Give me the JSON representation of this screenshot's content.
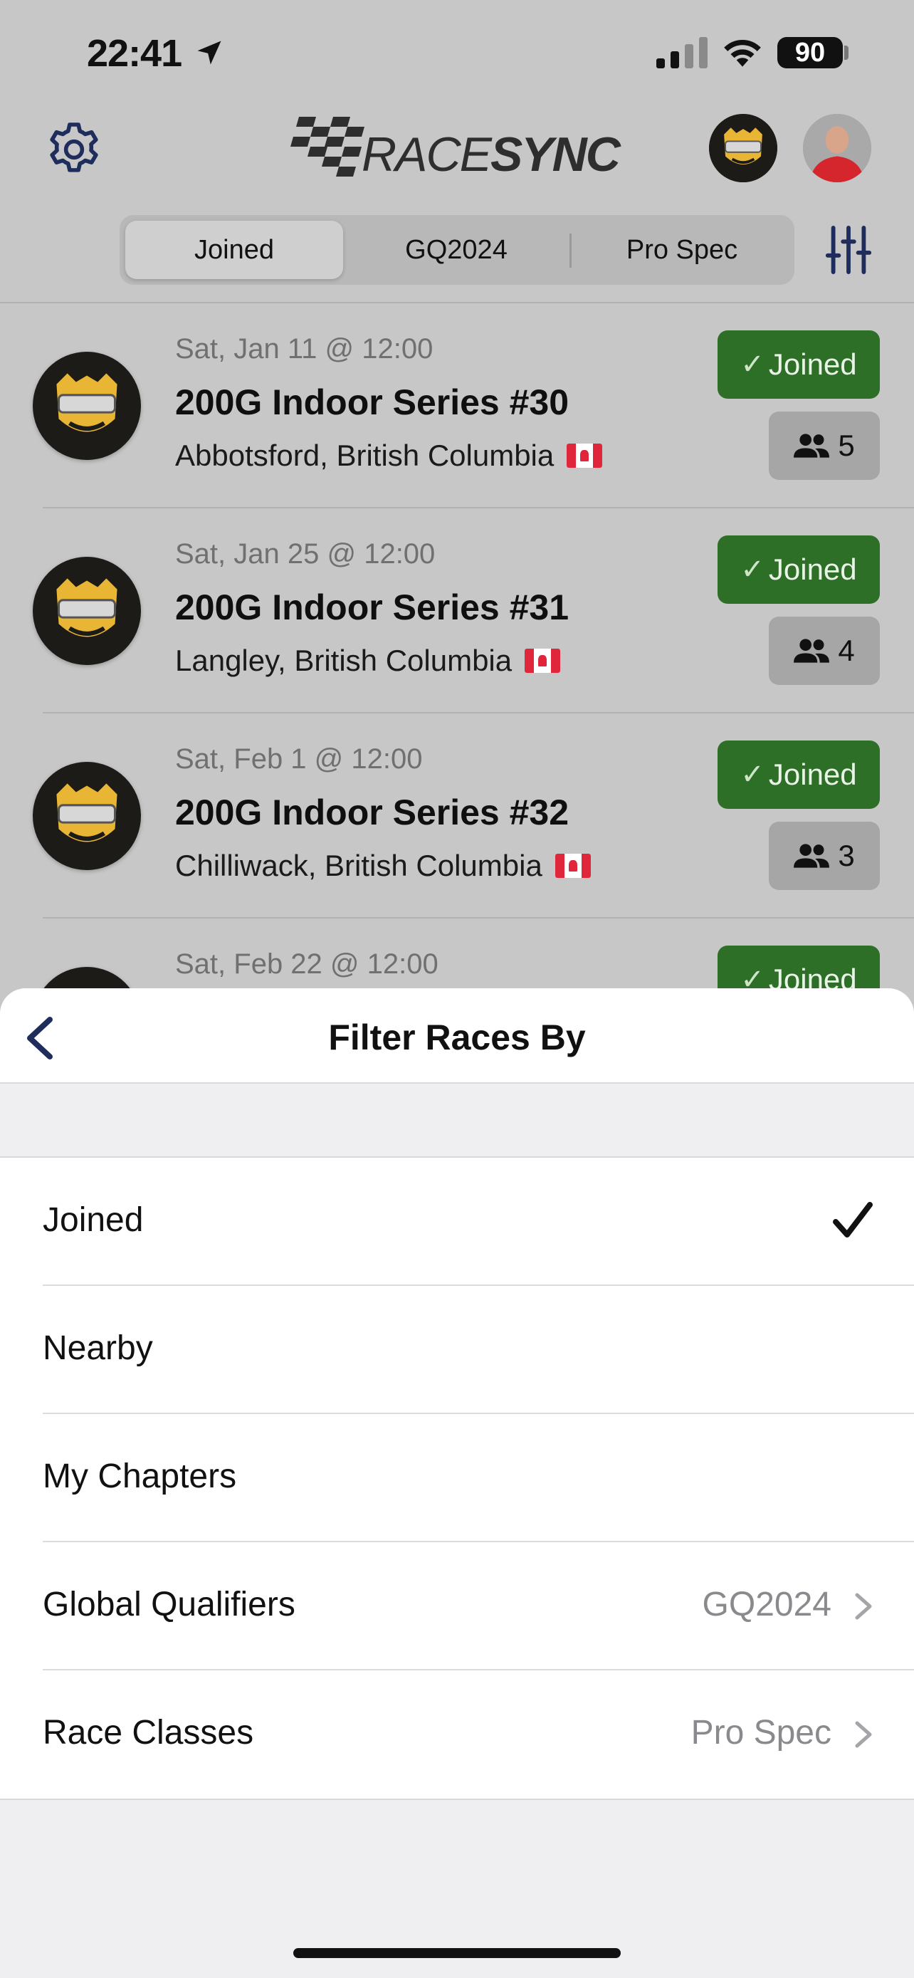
{
  "status_bar": {
    "time": "22:41",
    "battery": "90",
    "icons": [
      "location-arrow-icon",
      "cellular-signal-icon",
      "wifi-icon",
      "battery-icon"
    ]
  },
  "header": {
    "logo_text_light": "RACE",
    "logo_text_bold": "SYNC",
    "icons": [
      "gear-icon",
      "chapter-avatar",
      "user-avatar"
    ]
  },
  "segments": [
    {
      "label": "Joined",
      "active": true
    },
    {
      "label": "GQ2024",
      "active": false
    },
    {
      "label": "Pro Spec",
      "active": false
    }
  ],
  "races": [
    {
      "date": "Sat, Jan 11 @ 12:00",
      "title": "200G Indoor Series #30",
      "location": "Abbotsford, British Columbia",
      "status": "Joined",
      "count": "5"
    },
    {
      "date": "Sat, Jan 25 @ 12:00",
      "title": "200G Indoor Series #31",
      "location": "Langley, British Columbia",
      "status": "Joined",
      "count": "4"
    },
    {
      "date": "Sat, Feb 1 @ 12:00",
      "title": "200G Indoor Series #32",
      "location": "Chilliwack, British Columbia",
      "status": "Joined",
      "count": "3"
    },
    {
      "date": "Sat, Feb 22 @ 12:00",
      "title": "",
      "location": "",
      "status": "Joined",
      "count": ""
    }
  ],
  "sheet": {
    "title": "Filter Races By",
    "options": [
      {
        "label": "Joined",
        "value": "",
        "checked": true
      },
      {
        "label": "Nearby",
        "value": "",
        "checked": false
      },
      {
        "label": "My Chapters",
        "value": "",
        "checked": false
      },
      {
        "label": "Global Qualifiers",
        "value": "GQ2024",
        "checked": false
      },
      {
        "label": "Race Classes",
        "value": "Pro Spec",
        "checked": false
      }
    ]
  },
  "colors": {
    "joined_green": "#2e6f28",
    "overlay_gray": "#c7c7c7",
    "accent_navy": "#1f2d5c"
  }
}
